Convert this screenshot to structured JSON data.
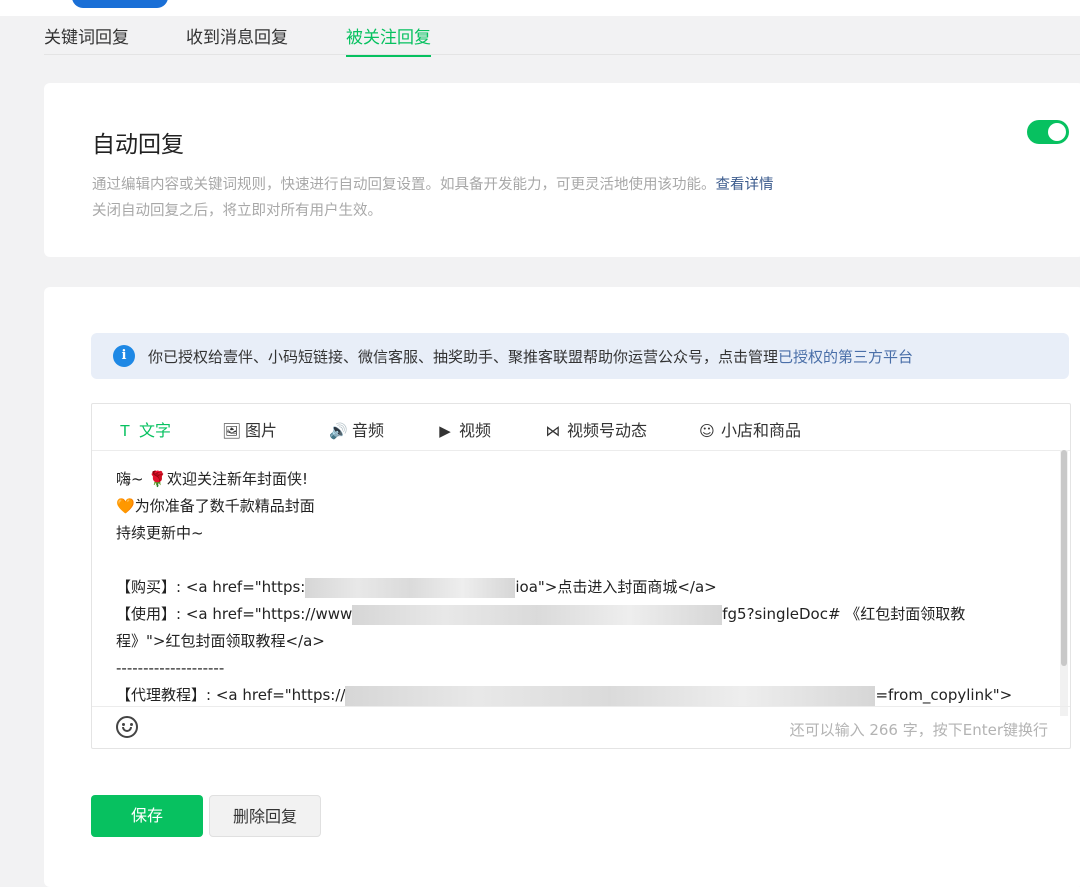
{
  "tabs": [
    "关键词回复",
    "收到消息回复",
    "被关注回复"
  ],
  "active_tab": 2,
  "auto_reply": {
    "title": "自动回复",
    "desc_1": "通过编辑内容或关键词规则，快速进行自动回复设置。如具备开发能力，可更灵活地使用该功能。",
    "desc_link": "查看详情",
    "desc_2": "关闭自动回复之后，将立即对所有用户生效。",
    "enabled": true
  },
  "notice": {
    "icon": "i",
    "text": "你已授权给壹伴、小码短链接、微信客服、抽奖助手、聚推客联盟帮助你运营公众号，点击管理",
    "link": "已授权的第三方平台"
  },
  "editor": {
    "tabs": [
      {
        "label": "文字",
        "icon": "T"
      },
      {
        "label": "图片",
        "icon": "🖼"
      },
      {
        "label": "音频",
        "icon": "🔊"
      },
      {
        "label": "视频",
        "icon": "▶"
      },
      {
        "label": "视频号动态",
        "icon": "⋈"
      },
      {
        "label": "小店和商品",
        "icon": "☺"
      }
    ],
    "lines": {
      "l1_a": "嗨~",
      "l1_emoji": "🌹",
      "l1_b": "欢迎关注新年封面侠!",
      "l2_emoji": "🧡",
      "l2_b": "为你准备了数千款精品封面",
      "l3": "持续更新中~",
      "l5_a": "【购买】: <a href=\"https:",
      "l5_b": "ioa\">点击进入封面商城</a>",
      "l6_a": "【使用】: <a href=\"https://www",
      "l6_b": "fg5?singleDoc# 《红包封面领取教",
      "l7": "程》\">红包封面领取教程</a>",
      "l8": "--------------------",
      "l9_a": "【代理教程】: <a href=\"https://",
      "l9_b": "=from_copylink\">"
    },
    "counter": "还可以输入 266 字，按下Enter键换行"
  },
  "buttons": {
    "save": "保存",
    "delete": "删除回复"
  },
  "colors": {
    "accent": "#07c160",
    "link": "#3a5a8c",
    "info": "#1e88e5"
  }
}
